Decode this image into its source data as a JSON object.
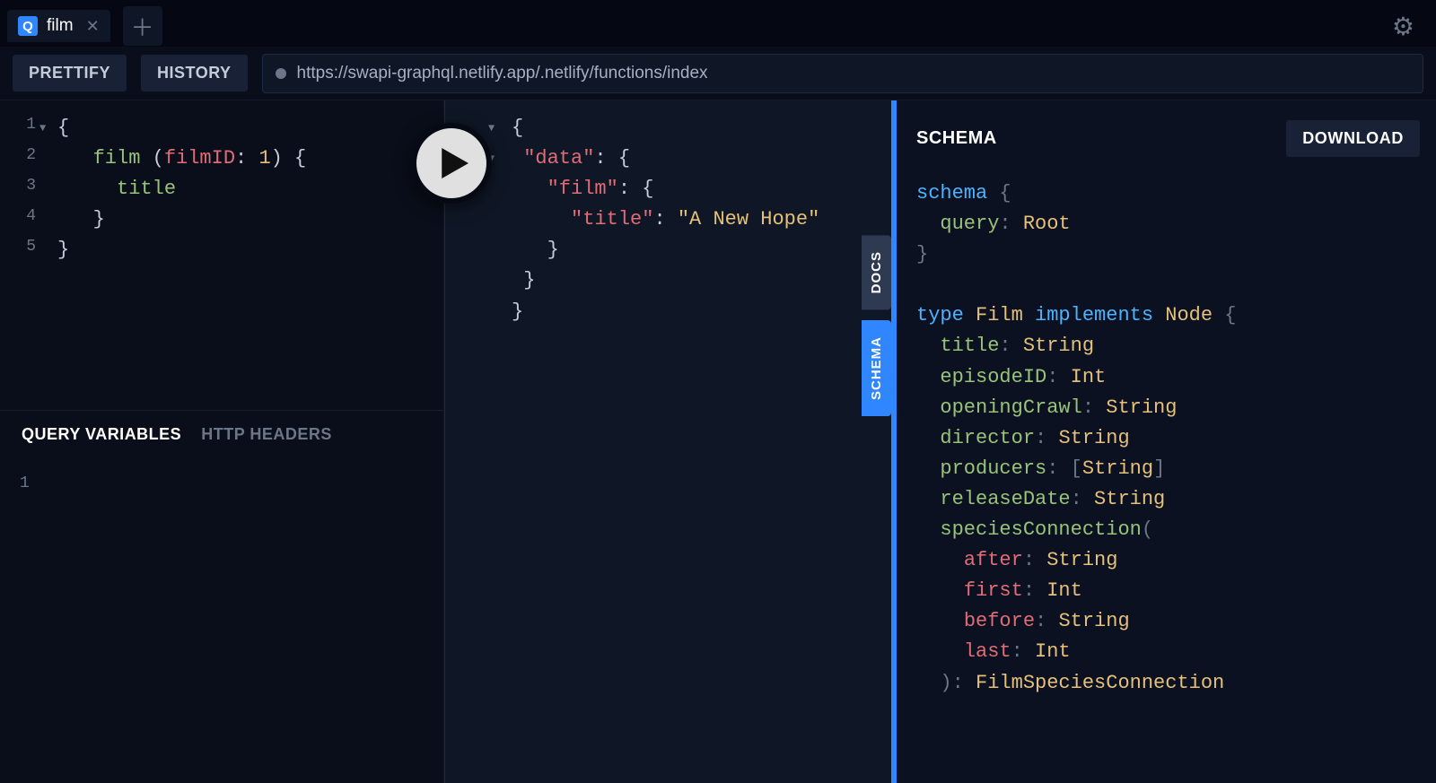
{
  "tabs": {
    "active": {
      "name": "film",
      "badge": "Q"
    }
  },
  "toolbar": {
    "prettify": "PRETTIFY",
    "history": "HISTORY",
    "endpoint": "https://swapi-graphql.netlify.app/.netlify/functions/index"
  },
  "query_editor": {
    "lines": [
      "1",
      "2",
      "3",
      "4",
      "5"
    ],
    "tokens": {
      "l1_open": "{",
      "l2_func": "film",
      "l2_open": " (",
      "l2_arg": "filmID",
      "l2_colon": ": ",
      "l2_val": "1",
      "l2_close": ") {",
      "l3_field": "title",
      "l4_close": "}",
      "l5_close": "}"
    }
  },
  "bottom_tabs": {
    "vars": "QUERY VARIABLES",
    "headers": "HTTP HEADERS",
    "line1": "1"
  },
  "result": {
    "tokens": {
      "l1_open": "{",
      "l2_key": "\"data\"",
      "l2_rest": ": {",
      "l3_key": "\"film\"",
      "l3_rest": ": {",
      "l4_key": "\"title\"",
      "l4_colon": ": ",
      "l4_val": "\"A New Hope\"",
      "l5_close": "}",
      "l6_close": "}",
      "l7_close": "}"
    }
  },
  "side_tabs": {
    "docs": "DOCS",
    "schema": "SCHEMA"
  },
  "schema_panel": {
    "title": "SCHEMA",
    "download": "DOWNLOAD",
    "tokens": {
      "s1_kw": "schema",
      "s1_open": " {",
      "s2_field": "query",
      "s2_colon": ": ",
      "s2_type": "Root",
      "s3_close": "}",
      "t_kw": "type",
      "t_name": "Film",
      "t_impl": "implements",
      "t_iface": "Node",
      "t_open": " {",
      "f1": "title",
      "f1t": "String",
      "f2": "episodeID",
      "f2t": "Int",
      "f3": "openingCrawl",
      "f3t": "String",
      "f4": "director",
      "f4t": "String",
      "f5": "producers",
      "f5t_open": "[",
      "f5t": "String",
      "f5t_close": "]",
      "f6": "releaseDate",
      "f6t": "String",
      "f7": "speciesConnection",
      "f7_open": "(",
      "a1": "after",
      "a1t": "String",
      "a2": "first",
      "a2t": "Int",
      "a3": "before",
      "a3t": "String",
      "a4": "last",
      "a4t": "Int",
      "f7_close": "): ",
      "f7t": "FilmSpeciesConnection"
    }
  }
}
